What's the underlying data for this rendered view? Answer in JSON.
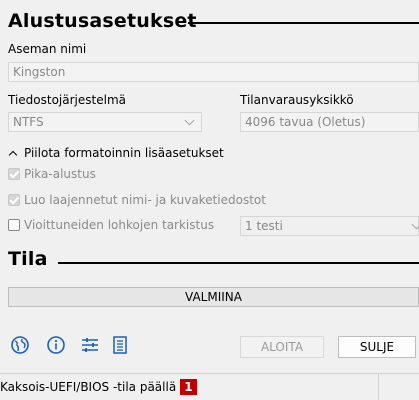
{
  "format_section": {
    "title": "Alustusasetukset",
    "volume_label": {
      "label": "Aseman nimi",
      "value": "Kingston"
    },
    "file_system": {
      "label": "Tiedostojärjestelmä",
      "value": "NTFS"
    },
    "cluster_size": {
      "label": "Tilanvarausyksikkö",
      "value": "4096 tavua (Oletus)"
    },
    "advanced_toggle": "Piilota formatoinnin lisäasetukset",
    "quick_format": {
      "label": "Pika-alustus",
      "checked": true
    },
    "extended_labels": {
      "label": "Luo laajennetut nimi- ja kuvaketiedostot",
      "checked": true
    },
    "bad_blocks": {
      "label": "Vioittuneiden lohkojen tarkistus",
      "checked": false,
      "passes": "1 testi"
    }
  },
  "status_section": {
    "title": "Tila",
    "progress_text": "VALMIINA"
  },
  "toolbar": {
    "icons": [
      "globe-icon",
      "info-icon",
      "settings-sliders-icon",
      "log-icon"
    ]
  },
  "buttons": {
    "start": "ALOITA",
    "close": "SULJE"
  },
  "statusbar": {
    "text": "Kaksois-UEFI/BIOS -tila päällä",
    "badge": "1"
  },
  "colors": {
    "icon_blue": "#1a5fb4",
    "badge_red": "#c00000"
  }
}
